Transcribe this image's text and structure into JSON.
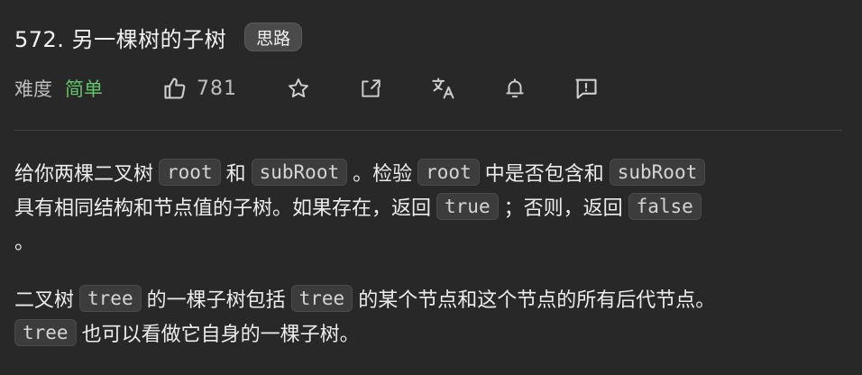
{
  "problem": {
    "title": "572. 另一棵树的子树",
    "tag": "思路"
  },
  "meta": {
    "difficulty_label": "难度",
    "difficulty_value": "简单",
    "difficulty_color": "#62c46a",
    "likes": "781",
    "icons": [
      "thumbs-up-icon",
      "star-icon",
      "share-icon",
      "translate-icon",
      "bell-icon",
      "feedback-icon"
    ]
  },
  "description": {
    "p1": {
      "t1": "给你两棵二叉树",
      "c1": "root",
      "t2": "和",
      "c2": "subRoot",
      "t3": "。检验",
      "c3": "root",
      "t4": "中是否包含和",
      "c4": "subRoot",
      "t5": "具有相同结构和节点值的子树。如果存在，返回",
      "c5": "true",
      "t6": "；否则，返回",
      "c6": "false",
      "t7": "。"
    },
    "p2": {
      "t1": "二叉树",
      "c1": "tree",
      "t2": "的一棵子树包括",
      "c2": "tree",
      "t3": "的某个节点和这个节点的所有后代节点。",
      "c3": "tree",
      "t4": "也可以看做它自身的一棵子树。"
    }
  }
}
